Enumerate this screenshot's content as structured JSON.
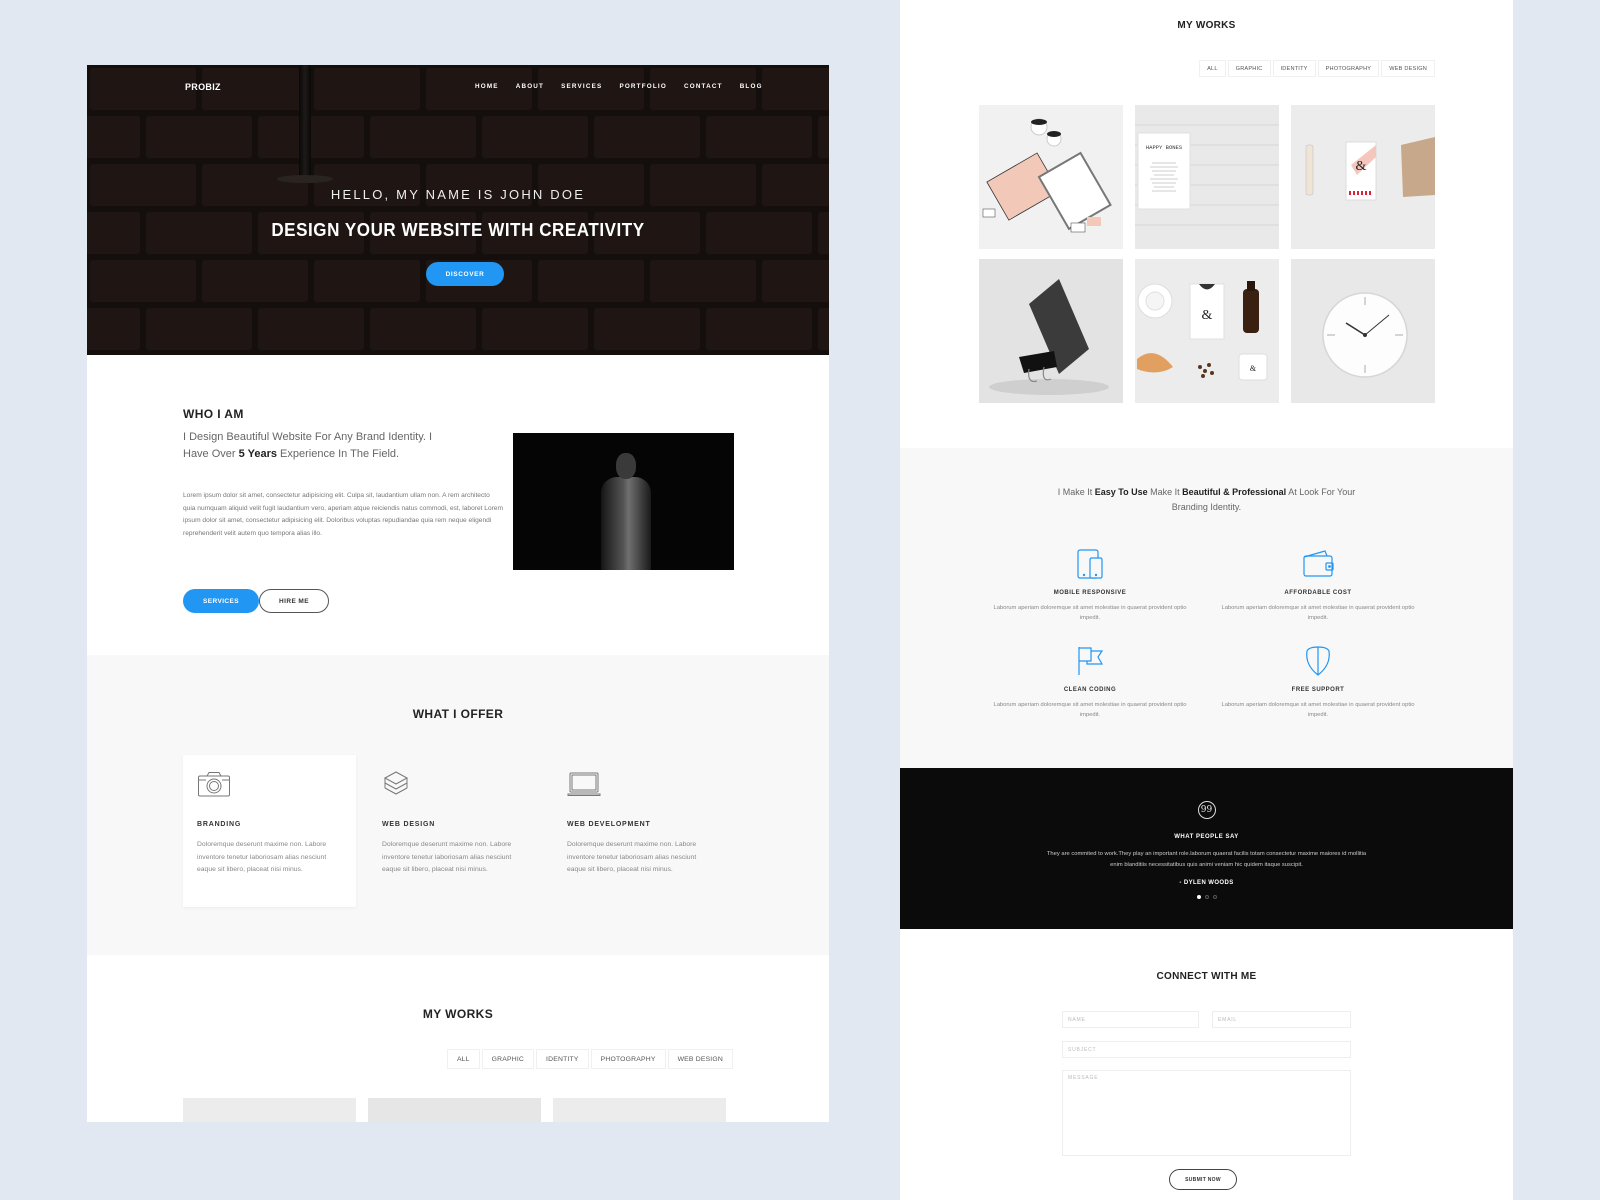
{
  "left_page": {
    "nav": {
      "brand": "PROBIZ",
      "links": [
        "HOME",
        "ABOUT",
        "SERVICES",
        "PORTFOLIO",
        "CONTACT",
        "BLOG"
      ]
    },
    "hero": {
      "subtitle": "HELLO, MY NAME IS JOHN DOE",
      "title": "DESIGN YOUR WEBSITE WITH CREATIVITY",
      "cta_label": "DISCOVER"
    },
    "who_i_am": {
      "heading": "WHO I AM",
      "lead_before": "I Design Beautiful Website For Any Brand Identity. I Have Over ",
      "lead_bold": "5 Years",
      "lead_after": " Experience In The Field.",
      "body": "Lorem ipsum dolor sit amet, consectetur adipisicing elit. Culpa sit, laudantium ullam non. A rem architecto quia numquam aliquid velit fugit laudantium vero, aperiam atque reiciendis natus commodi, est, laboret Lorem ipsum dolor sit amet, consectetur adipisicing elit. Doloribus voluptas repudiandae quia rem neque eligendi reprehenderit velit autem quo tempora alias illo.",
      "services_label": "SERVICES",
      "hire_label": "HIRE ME"
    },
    "offer": {
      "heading": "WHAT I OFFER",
      "cards": [
        {
          "icon": "camera-icon",
          "title": "BRANDING",
          "text": "Doloremque deserunt maxime non. Labore inventore tenetur laboriosam alias nesciunt eaque sit libero, placeat nisi minus."
        },
        {
          "icon": "layers-icon",
          "title": "WEB DESIGN",
          "text": "Doloremque deserunt maxime non. Labore inventore tenetur laboriosam alias nesciunt eaque sit libero, placeat nisi minus."
        },
        {
          "icon": "laptop-icon",
          "title": "WEB DEVELOPMENT",
          "text": "Doloremque deserunt maxime non. Labore inventore tenetur laboriosam alias nesciunt eaque sit libero, placeat nisi minus."
        }
      ]
    },
    "works": {
      "heading": "MY WORKS",
      "filters": [
        "ALL",
        "GRAPHIC",
        "IDENTITY",
        "PHOTOGRAPHY",
        "WEB DESIGN"
      ]
    }
  },
  "right_page": {
    "works": {
      "heading": "MY WORKS",
      "filters": [
        "ALL",
        "GRAPHIC",
        "IDENTITY",
        "PHOTOGRAPHY",
        "WEB DESIGN"
      ],
      "tiles": [
        {
          "name": "stationery-mockup"
        },
        {
          "name": "happy-bones-menu",
          "caption": "HAPPY BONES"
        },
        {
          "name": "matchbox-branding"
        },
        {
          "name": "book-binder-clip"
        },
        {
          "name": "coffee-branding"
        },
        {
          "name": "wall-clock"
        }
      ]
    },
    "features": {
      "lead_parts": [
        "I Make It ",
        "Easy To Use",
        " Make It ",
        "Beautiful & Professional",
        " At Look For Your Branding Identity."
      ],
      "items": [
        {
          "icon": "devices-icon",
          "title": "MOBILE RESPONSIVE",
          "text": "Laborum aperiam doloremque sit amet molestiae in quaerat provident optio impedit."
        },
        {
          "icon": "wallet-icon",
          "title": "AFFORDABLE COST",
          "text": "Laborum aperiam doloremque sit amet molestiae in quaerat provident optio impedit."
        },
        {
          "icon": "flag-icon",
          "title": "CLEAN CODING",
          "text": "Laborum aperiam doloremque sit amet molestiae in quaerat provident optio impedit."
        },
        {
          "icon": "shield-icon",
          "title": "FREE SUPPORT",
          "text": "Laborum aperiam doloremque sit amet molestiae in quaerat provident optio impedit."
        }
      ],
      "accent_color": "#2196f3"
    },
    "testimonial": {
      "quote_glyph": "99",
      "heading": "WHAT PEOPLE SAY",
      "text": "They are commited to work.They play an important role.laborum quaerat facilis totam consectetur maxime maiores id mollitia enim blanditiis necessitatibus quis animi veniam hic quidem itaque suscipit.",
      "author": "- DYLEN WOODS",
      "slides": 3,
      "active_slide": 1
    },
    "contact": {
      "heading": "CONNECT WITH ME",
      "name_placeholder": "NAME",
      "email_placeholder": "EMAIL",
      "subject_placeholder": "SUBJECT",
      "message_placeholder": "MESSAGE",
      "submit_label": "SUBMIT NOW"
    }
  },
  "colors": {
    "accent": "#2196f3",
    "page_bg": "#e2e8f2",
    "dark": "#0b0b0c"
  }
}
